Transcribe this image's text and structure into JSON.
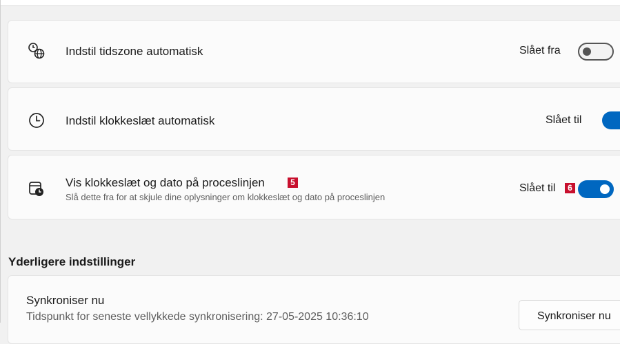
{
  "settings": {
    "timezone_auto": {
      "label": "Indstil tidszone automatisk",
      "status": "Slået fra",
      "icon": "globe-clock-icon",
      "on": false
    },
    "time_auto": {
      "label": "Indstil klokkeslæt automatisk",
      "status": "Slået til",
      "icon": "clock-icon",
      "on": true
    },
    "taskbar_clock": {
      "label": "Vis klokkeslæt og dato på proceslinjen",
      "description": "Slå dette fra for at skjule dine oplysninger om klokkeslæt og dato på proceslinjen",
      "status": "Slået til",
      "icon": "calendar-clock-icon",
      "on": true,
      "badge_label": "5",
      "badge_toggle": "6"
    }
  },
  "additional": {
    "heading": "Yderligere indstillinger",
    "sync": {
      "title": "Synkroniser nu",
      "subtitle": "Tidspunkt for seneste vellykkede synkronisering: 27-05-2025 10:36:10",
      "button_label": "Synkroniser nu"
    }
  },
  "colors": {
    "accent": "#0067c0",
    "badge": "#c8102e"
  }
}
